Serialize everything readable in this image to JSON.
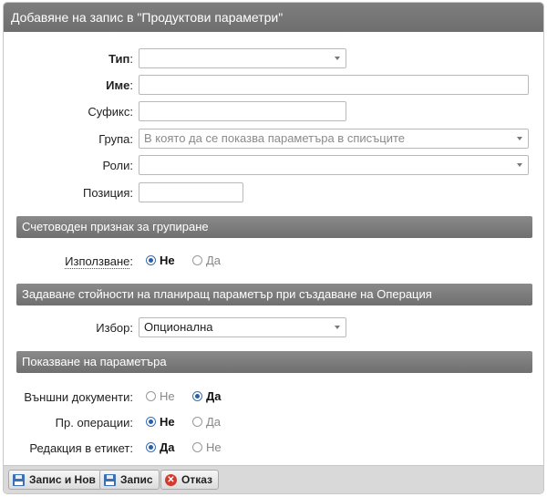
{
  "dialog": {
    "title": "Добавяне на запис в \"Продуктови параметри\""
  },
  "fields": {
    "type": {
      "label": "Тип",
      "value": ""
    },
    "name": {
      "label": "Име",
      "value": ""
    },
    "suffix": {
      "label": "Суфикс",
      "value": ""
    },
    "group": {
      "label": "Група",
      "placeholder": "В която да се показва параметъра в списъците"
    },
    "roles": {
      "label": "Роли",
      "value": ""
    },
    "position": {
      "label": "Позиция",
      "value": ""
    }
  },
  "sections": {
    "accounting": "Счетоводен признак за групиране",
    "planning": "Задаване стойности на планиращ параметър при създаване на Операция",
    "display": "Показване на параметъра"
  },
  "usage": {
    "label": "Използване",
    "options": [
      "Не",
      "Да"
    ],
    "selected": "Не"
  },
  "choice": {
    "label": "Избор",
    "value": "Опционална"
  },
  "display": {
    "external_docs": {
      "label": "Външни документи",
      "options": [
        "Не",
        "Да"
      ],
      "selected": "Да"
    },
    "operations": {
      "label": "Пр. операции",
      "options": [
        "Не",
        "Да"
      ],
      "selected": "Не"
    },
    "label_edit": {
      "label": "Редакция в етикет",
      "options": [
        "Да",
        "Не"
      ],
      "selected": "Да"
    }
  },
  "footer": {
    "save_new": "Запис и Нов",
    "save": "Запис",
    "cancel": "Отказ"
  },
  "colors": {
    "header": "#757575",
    "section": "#7c7c7c",
    "radio_selected": "#2a5ea8",
    "cancel_icon": "#d23a2f"
  }
}
